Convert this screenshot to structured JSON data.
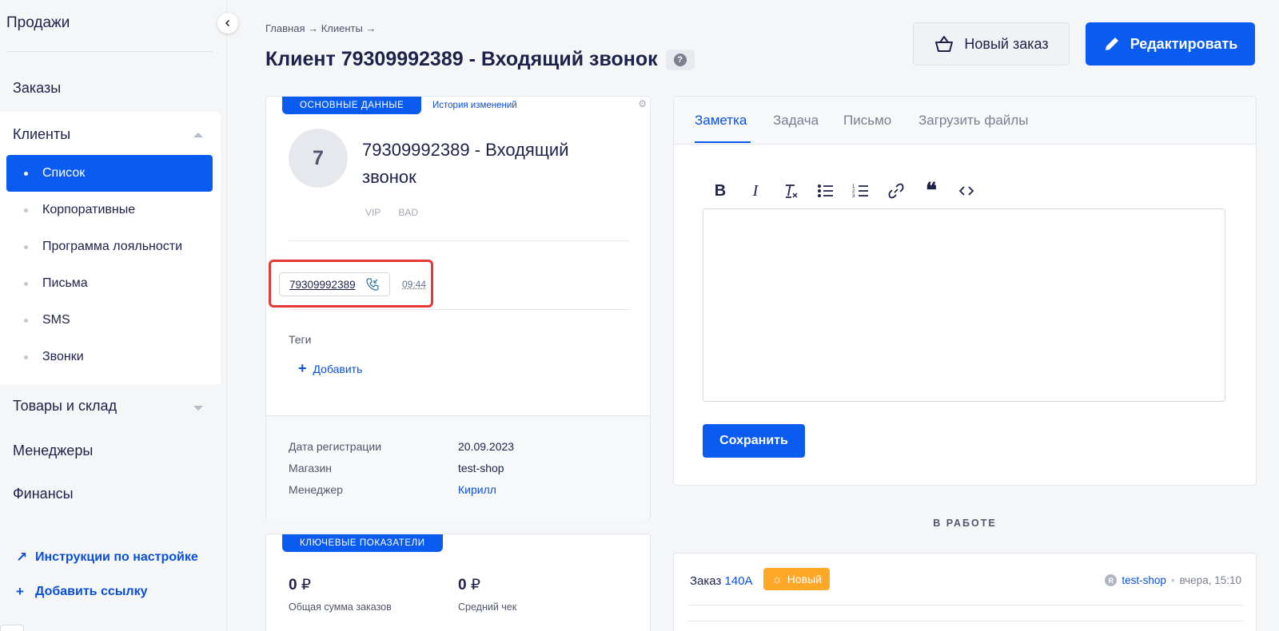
{
  "sidebar": {
    "top_title": "Продажи",
    "orders": "Заказы",
    "clients_group": {
      "title": "Клиенты",
      "items": [
        {
          "label": "Список"
        },
        {
          "label": "Корпоративные"
        },
        {
          "label": "Программа лояльности"
        },
        {
          "label": "Письма"
        },
        {
          "label": "SMS"
        },
        {
          "label": "Звонки"
        }
      ]
    },
    "goods": "Товары и склад",
    "managers": "Менеджеры",
    "finance": "Финансы",
    "links": [
      {
        "icon": "↗",
        "label": "Инструкции по настройке"
      },
      {
        "icon": "+",
        "label": "Добавить ссылку"
      }
    ]
  },
  "header": {
    "breadcrumb": "Главная → Клиенты →",
    "title": "Клиент 79309992389 - Входящий звонок",
    "help": "?",
    "new_order": "Новый заказ",
    "edit": "Редактировать"
  },
  "client_card": {
    "tab_active": "ОСНОВНЫЕ ДАННЫЕ",
    "tab_history": "История изменений",
    "avatar_letter": "7",
    "name": "79309992389 - Входящий звонок",
    "badges": [
      "VIP",
      "BAD"
    ],
    "phone": "79309992389",
    "phone_time": "09:44",
    "tags_label": "Теги",
    "add_tag": "Добавить",
    "info": [
      {
        "label": "Дата регистрации",
        "value": "20.09.2023"
      },
      {
        "label": "Магазин",
        "value": "test-shop"
      },
      {
        "label": "Менеджер",
        "value": "Кирилл"
      }
    ]
  },
  "kpi": {
    "tab": "КЛЮЧЕВЫЕ ПОКАЗАТЕЛИ",
    "items": [
      {
        "value": "0",
        "currency": "₽",
        "caption": "Общая сумма заказов"
      },
      {
        "value": "0",
        "currency": "₽",
        "caption": "Средний чек"
      }
    ]
  },
  "note": {
    "tabs": [
      "Заметка",
      "Задача",
      "Письмо",
      "Загрузить файлы"
    ],
    "save": "Сохранить"
  },
  "in_work": {
    "title": "В РАБОТЕ",
    "order": {
      "prefix": "Заказ",
      "number": "140А",
      "status": "Новый",
      "status_color": "#ffa726",
      "shop": "test-shop",
      "time": "вчера, 15:10"
    }
  },
  "colors": {
    "accent": "#0a5cf0",
    "highlight": "#e53935"
  }
}
